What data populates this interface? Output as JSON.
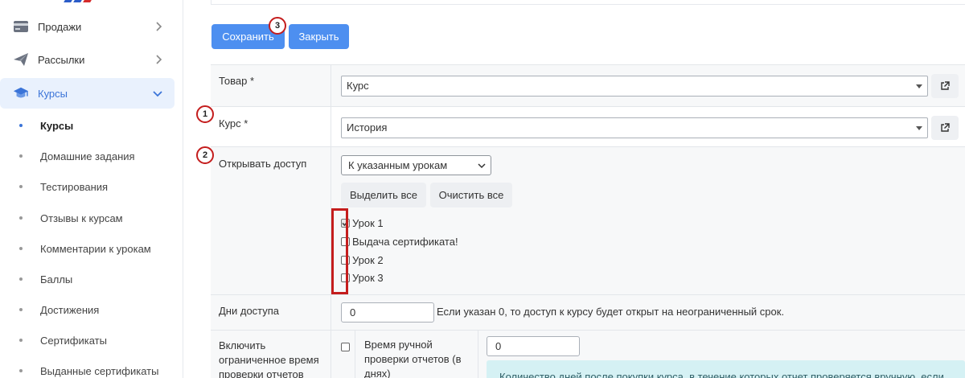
{
  "sidebar": {
    "menu": [
      {
        "label": "Продажи",
        "icon": "card-icon"
      },
      {
        "label": "Рассылки",
        "icon": "paper-plane-icon"
      },
      {
        "label": "Курсы",
        "icon": "graduation-cap-icon"
      }
    ],
    "submenu": [
      {
        "label": "Курсы"
      },
      {
        "label": "Домашние задания"
      },
      {
        "label": "Тестирования"
      },
      {
        "label": "Отзывы к курсам"
      },
      {
        "label": "Комментарии к урокам"
      },
      {
        "label": "Баллы"
      },
      {
        "label": "Достижения"
      },
      {
        "label": "Сертификаты"
      },
      {
        "label": "Выданные сертификаты"
      }
    ]
  },
  "toolbar": {
    "save_label": "Сохранить",
    "close_label": "Закрыть"
  },
  "badges": {
    "one": "1",
    "two": "2",
    "three": "3"
  },
  "form": {
    "product": {
      "label": "Товар *",
      "value": "Курс"
    },
    "course": {
      "label": "Курс *",
      "value": "История"
    },
    "access": {
      "label": "Открывать доступ",
      "mode": "К указанным урокам",
      "select_all": "Выделить все",
      "clear_all": "Очистить все",
      "lessons": [
        {
          "label": "Урок 1",
          "checked": true
        },
        {
          "label": "Выдача сертификата!",
          "checked": false
        },
        {
          "label": "Урок 2",
          "checked": false
        },
        {
          "label": "Урок 3",
          "checked": false
        }
      ]
    },
    "days": {
      "label": "Дни доступа",
      "value": "0",
      "hint": "Если указан 0, то доступ к курсу будет открыт на неограниченный срок."
    },
    "manual_check": {
      "label": "Включить ограниченное время проверки отчетов",
      "sub_label": "Время ручной проверки отчетов (в днях)",
      "value": "0",
      "info": "Количество дней после покупки курса, в течение которых отчет проверяется вручную, если"
    }
  },
  "colors": {
    "primary": "#4d8ff0",
    "active_bg": "#e9f1fd",
    "active_text": "#3b74d8",
    "annotation": "#c41d1d",
    "info_bg": "#d5f1f4"
  }
}
